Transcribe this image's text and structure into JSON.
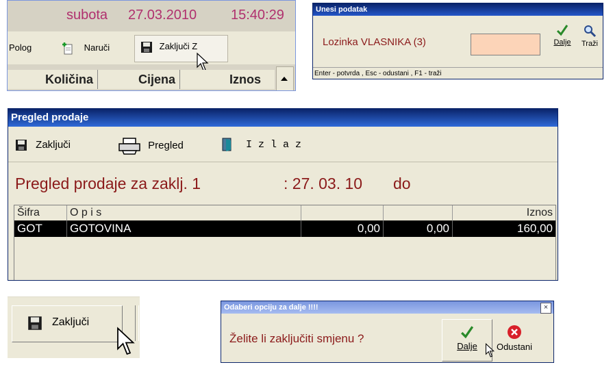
{
  "panel1": {
    "day": "subota",
    "date": "27.03.2010",
    "time": "15:40:29",
    "toolbar": {
      "pologLabel": "Polog",
      "naruciLabel": "Naruči",
      "zakljuciZLabel": "Zaključi Z"
    },
    "columns": [
      "Količina",
      "Cijena",
      "Iznos"
    ]
  },
  "unesi": {
    "title": "Unesi podatak",
    "label": "Lozinka VLASNIKA (3)",
    "inputValue": "",
    "dalje": "Dalje",
    "trazi": "Traži",
    "status": "Enter - potvrda  ,  Esc - odustani  ,  F1 - traži",
    "inputColor": "#fcd4b8"
  },
  "pregled": {
    "title": "Pregled prodaje",
    "toolbar": {
      "zakljuci": "Zaključi",
      "pregled": "Pregled",
      "izlaz": "I z l a z"
    },
    "heading": "Pregled prodaje za zaklj. 1",
    "date": ": 27. 03. 10",
    "do": "do",
    "grid": {
      "headers": [
        "Šifra",
        "O p i s",
        "",
        "",
        "Iznos"
      ],
      "rows": [
        {
          "sifra": "GOT",
          "opis": "GOTOVINA",
          "v1": "0,00",
          "v2": "0,00",
          "iznos": "160,00"
        }
      ]
    },
    "headingColor": "#8b1a1a"
  },
  "zakljuciZoom": {
    "label": "Zaključi"
  },
  "odaberi": {
    "title": "Odaberi opciju za dalje  !!!!",
    "close": "×",
    "question": "Želite  li zaključiti smjenu ?",
    "dalje": "Dalje",
    "odustani": "Odustani"
  }
}
